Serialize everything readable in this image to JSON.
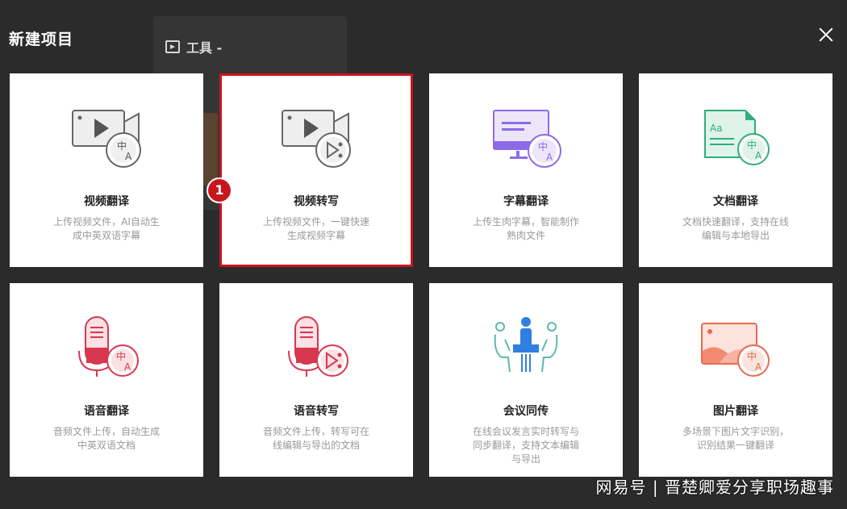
{
  "dialog": {
    "title": "新建项目"
  },
  "background": {
    "tab_label": "工具 -"
  },
  "cards": [
    {
      "name": "视频翻译",
      "desc": "上传视频文件，AI自动生成中英双语字幕"
    },
    {
      "name": "视频转写",
      "desc": "上传视频文件，一键快速生成视频字幕"
    },
    {
      "name": "字幕翻译",
      "desc": "上传生肉字幕，智能制作熟肉文件"
    },
    {
      "name": "文档翻译",
      "desc": "文档快速翻译，支持在线编辑与本地导出"
    },
    {
      "name": "语音翻译",
      "desc": "音频文件上传，自动生成中英双语文档"
    },
    {
      "name": "语音转写",
      "desc": "音频文件上传，转写可在线编辑与导出的文档"
    },
    {
      "name": "会议同传",
      "desc": "在线会议发言实时转写与同步翻译，支持文本编辑与导出"
    },
    {
      "name": "图片翻译",
      "desc": "多场景下图片文字识别，识别结果一键翻译"
    }
  ],
  "badge": {
    "number": "1"
  },
  "watermark": "网易号 | 晋楚卿爱分享职场趣事",
  "colors": {
    "accent": "#c8161d",
    "overlay": "#2b2b2b"
  }
}
